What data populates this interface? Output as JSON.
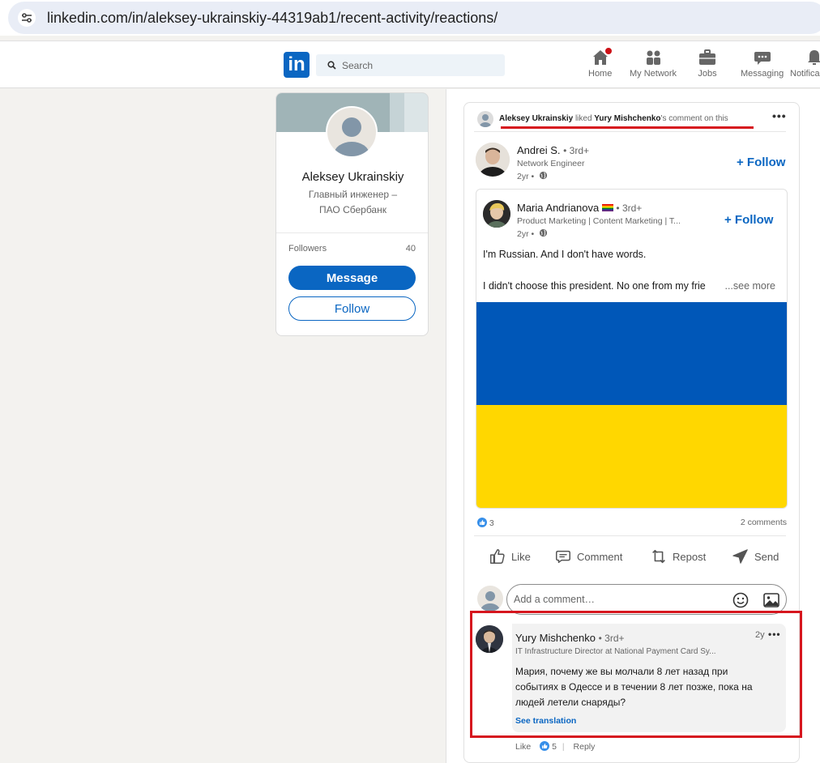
{
  "browser": {
    "url": "linkedin.com/in/aleksey-ukrainskiy-44319ab1/recent-activity/reactions/"
  },
  "header": {
    "logo_text": "in",
    "search_placeholder": "Search",
    "nav": [
      {
        "label": "Home",
        "icon": "home-icon"
      },
      {
        "label": "My Network",
        "icon": "network-icon"
      },
      {
        "label": "Jobs",
        "icon": "briefcase-icon"
      },
      {
        "label": "Messaging",
        "icon": "messaging-icon"
      },
      {
        "label": "Notifica",
        "icon": "bell-icon"
      }
    ]
  },
  "profile": {
    "name": "Aleksey Ukrainskiy",
    "headline_line1": "Главный инженер –",
    "headline_line2": "ПАО Сбербанк",
    "followers_label": "Followers",
    "followers_count": "40",
    "message_label": "Message",
    "follow_label": "Follow"
  },
  "activity": {
    "actor": "Aleksey Ukrainskiy",
    "verb": " liked ",
    "target": "Yury Mishchenko",
    "suffix": "'s comment on this"
  },
  "post": {
    "reposter_name": "Andrei S.",
    "reposter_degree": "• 3rd+",
    "reposter_title": "Network Engineer",
    "reposter_time": "2yr •",
    "reposter_follow": "+ Follow",
    "author_name": "Maria Andrianova",
    "author_degree": "• 3rd+",
    "author_title": "Product Marketing | Content Marketing | T...",
    "author_time": "2yr •",
    "author_follow": "+ Follow",
    "text_line1": "I'm Russian. And I don't have words.",
    "text_line2": "I didn't choose this president. No one from my frie",
    "see_more": "...see more",
    "reaction_count": "3",
    "comments_count": "2 comments",
    "actions": [
      {
        "label": "Like",
        "icon": "like-icon"
      },
      {
        "label": "Comment",
        "icon": "comment-icon"
      },
      {
        "label": "Repost",
        "icon": "repost-icon"
      },
      {
        "label": "Send",
        "icon": "send-icon"
      }
    ],
    "comment_placeholder": "Add a comment…",
    "colors": {
      "flag_blue": "#0057b8",
      "flag_yellow": "#ffd700",
      "brand": "#0a66c2",
      "highlight": "#d6161e"
    }
  },
  "comment": {
    "author": "Yury Mishchenko",
    "degree": "• 3rd+",
    "title": "IT Infrastructure Director at National Payment Card Sy...",
    "time": "2y",
    "line1": "Мария, почему же вы молчали 8 лет назад при",
    "line2": "событиях в Одессе и в течении 8 лет позже, пока на",
    "line3": "людей летели снаряды?",
    "see_translation": "See translation",
    "like_label": "Like",
    "like_count": "5",
    "separator": "|",
    "reply_label": "Reply"
  }
}
